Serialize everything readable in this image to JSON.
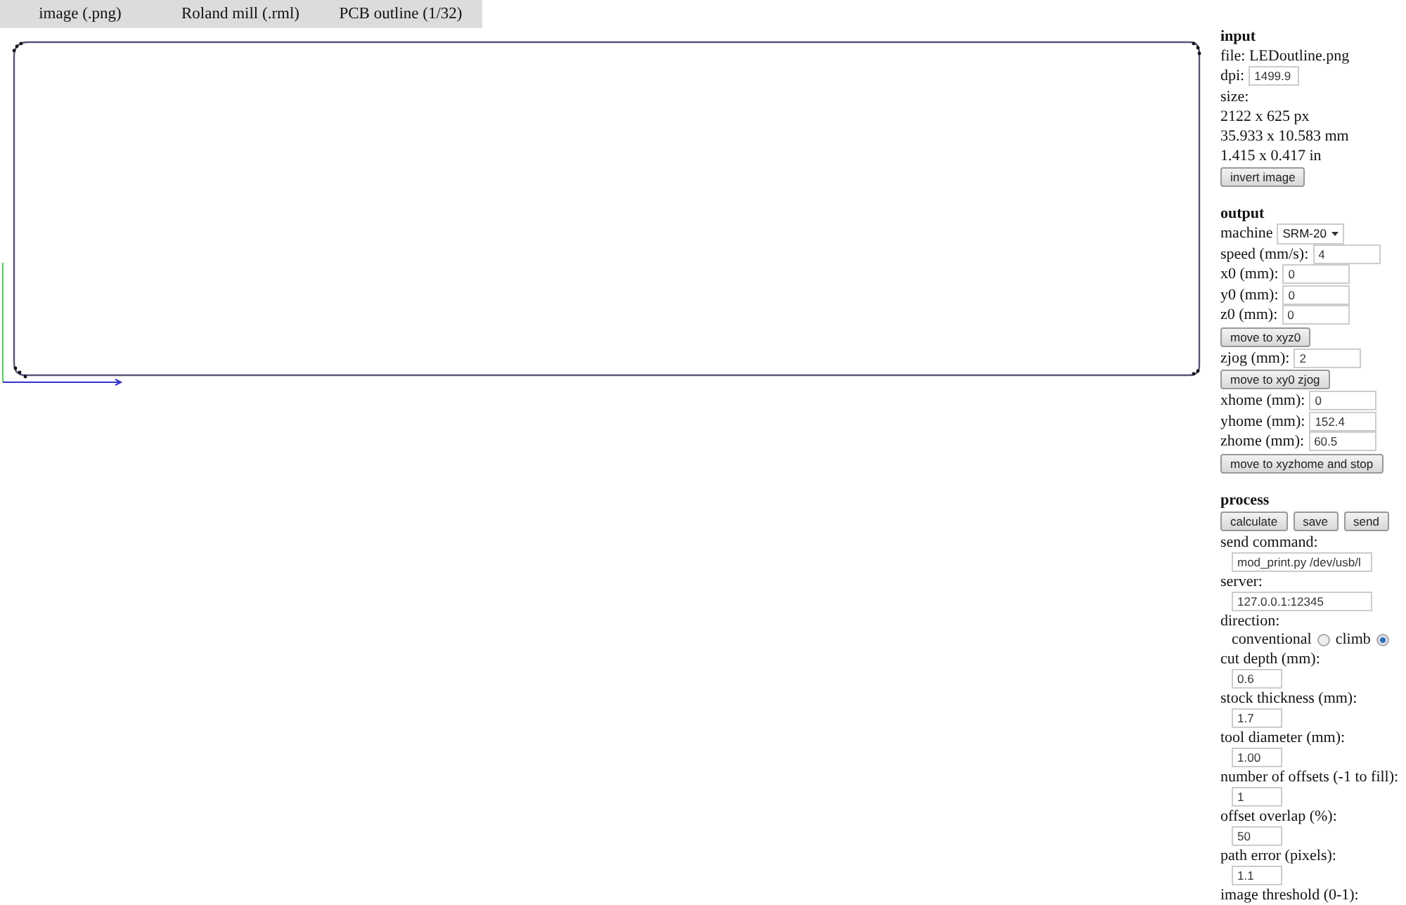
{
  "menu": [
    {
      "label": "image (.png)"
    },
    {
      "label": "Roland mill (.rml)"
    },
    {
      "label": "PCB outline (1/32)"
    }
  ],
  "sections": [
    {
      "title": "input",
      "items": [
        {
          "kind": "text",
          "text": "file: LEDoutline.png"
        },
        {
          "kind": "field-short",
          "label": "dpi:",
          "value": "1499.9"
        },
        {
          "kind": "text",
          "text": "size:"
        },
        {
          "kind": "text",
          "text": "2122 x 625 px"
        },
        {
          "kind": "text",
          "text": "35.933 x 10.583 mm"
        },
        {
          "kind": "text",
          "text": "1.415 x 0.417 in"
        },
        {
          "kind": "button",
          "label": "invert image"
        }
      ]
    },
    {
      "title": "output",
      "items": [
        {
          "kind": "select",
          "label": "machine",
          "value": "SRM-20"
        },
        {
          "kind": "field",
          "label": "speed (mm/s):",
          "value": "4"
        },
        {
          "kind": "field",
          "label": "x0 (mm):",
          "value": "0"
        },
        {
          "kind": "field",
          "label": "y0 (mm):",
          "value": "0"
        },
        {
          "kind": "field",
          "label": "z0 (mm):",
          "value": "0"
        },
        {
          "kind": "button",
          "label": "move to xyz0"
        },
        {
          "kind": "field",
          "label": "zjog (mm):",
          "value": "2"
        },
        {
          "kind": "button",
          "label": "move to xy0 zjog"
        },
        {
          "kind": "field",
          "label": "xhome (mm):",
          "value": "0"
        },
        {
          "kind": "field",
          "label": "yhome (mm):",
          "value": "152.4"
        },
        {
          "kind": "field",
          "label": "zhome (mm):",
          "value": "60.5"
        },
        {
          "kind": "button",
          "label": "move to xyzhome and stop"
        }
      ]
    },
    {
      "title": "process",
      "items": [
        {
          "kind": "buttons",
          "labels": [
            "calculate",
            "save",
            "send"
          ]
        },
        {
          "kind": "stacked-wide",
          "label": "send command:",
          "value": "mod_print.py /dev/usb/l"
        },
        {
          "kind": "stacked-wide",
          "label": "server:",
          "value": "127.0.0.1:12345"
        },
        {
          "kind": "text",
          "text": "direction:"
        },
        {
          "kind": "radio",
          "options": [
            {
              "label": "conventional",
              "selected": false
            },
            {
              "label": "climb",
              "selected": true
            }
          ]
        },
        {
          "kind": "stacked",
          "label": "cut depth (mm):",
          "value": "0.6"
        },
        {
          "kind": "stacked",
          "label": "stock thickness (mm):",
          "value": "1.7"
        },
        {
          "kind": "stacked",
          "label": "tool diameter (mm):",
          "value": "1.00"
        },
        {
          "kind": "stacked",
          "label": "number of offsets (-1 to fill):",
          "value": "1"
        },
        {
          "kind": "stacked",
          "label": "offset overlap (%):",
          "value": "50"
        },
        {
          "kind": "stacked",
          "label": "path error (pixels):",
          "value": "1.1"
        },
        {
          "kind": "text",
          "text": "image threshold (0-1):"
        }
      ]
    }
  ]
}
